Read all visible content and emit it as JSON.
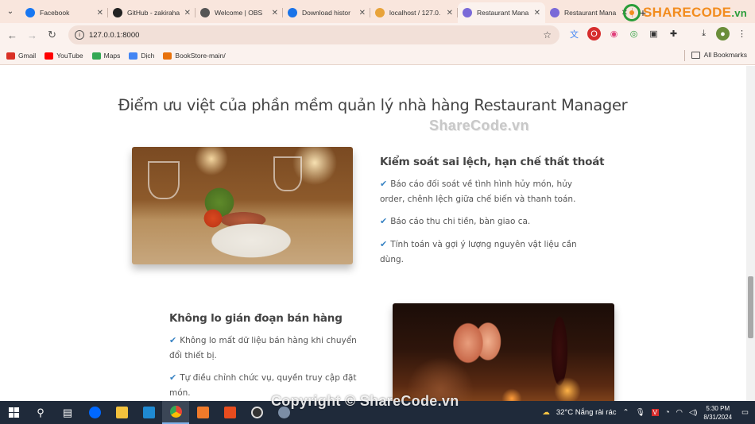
{
  "browser": {
    "tabs": [
      {
        "title": "Facebook",
        "icon": "facebook-icon",
        "color": "#1877f2",
        "active": false
      },
      {
        "title": "GitHub - zakiraha",
        "icon": "github-icon",
        "color": "#222222",
        "active": false
      },
      {
        "title": "Welcome | OBS",
        "icon": "globe-icon",
        "color": "#555555",
        "active": false
      },
      {
        "title": "Download histor",
        "icon": "download-icon",
        "color": "#1a73e8",
        "active": false
      },
      {
        "title": "localhost / 127.0.",
        "icon": "phpmyadmin-icon",
        "color": "#e8a33a",
        "active": false
      },
      {
        "title": "Restaurant Mana",
        "icon": "restaurant-icon",
        "color": "#7a6ad8",
        "active": true
      },
      {
        "title": "Restaurant Mana",
        "icon": "restaurant-icon",
        "color": "#7a6ad8",
        "active": false
      }
    ],
    "url": "127.0.0.1:8000",
    "bookmarks": [
      {
        "label": "Gmail",
        "icon": "gmail-icon",
        "color": "#d93025"
      },
      {
        "label": "YouTube",
        "icon": "youtube-icon",
        "color": "#ff0000"
      },
      {
        "label": "Maps",
        "icon": "maps-icon",
        "color": "#34a853"
      },
      {
        "label": "Dịch",
        "icon": "translate-icon",
        "color": "#4285f4"
      },
      {
        "label": "BookStore-main/",
        "icon": "bookstore-icon",
        "color": "#e8710a"
      }
    ],
    "all_bookmarks": "All Bookmarks"
  },
  "logo": {
    "brand": "SHARECODE",
    "suffix": ".vn"
  },
  "page": {
    "heading": "Điểm ưu việt của phần mềm quản lý nhà hàng Restaurant Manager",
    "watermark": "ShareCode.vn",
    "feature1": {
      "title": "Kiểm soát sai lệch, hạn chế thất thoát",
      "items": [
        "Báo cáo đối soát về tình hình hủy món, hủy order, chênh lệch giữa chế biến và thanh toán.",
        "Báo cáo thu chi tiền, bàn giao ca.",
        "Tính toán và gợi ý lượng nguyên vật liệu cần dùng."
      ]
    },
    "feature2": {
      "title": "Không lo gián đoạn bán hàng",
      "items": [
        "Không lo mất dữ liệu bán hàng khi chuyển đổi thiết bị.",
        "Tự điều chỉnh chức vụ, quyền truy cập đặt món."
      ]
    }
  },
  "taskbar": {
    "copyright": "Copyright © ShareCode.vn",
    "weather": "32°C  Nắng rải rác",
    "time": "5:30 PM",
    "date": "8/31/2024"
  }
}
